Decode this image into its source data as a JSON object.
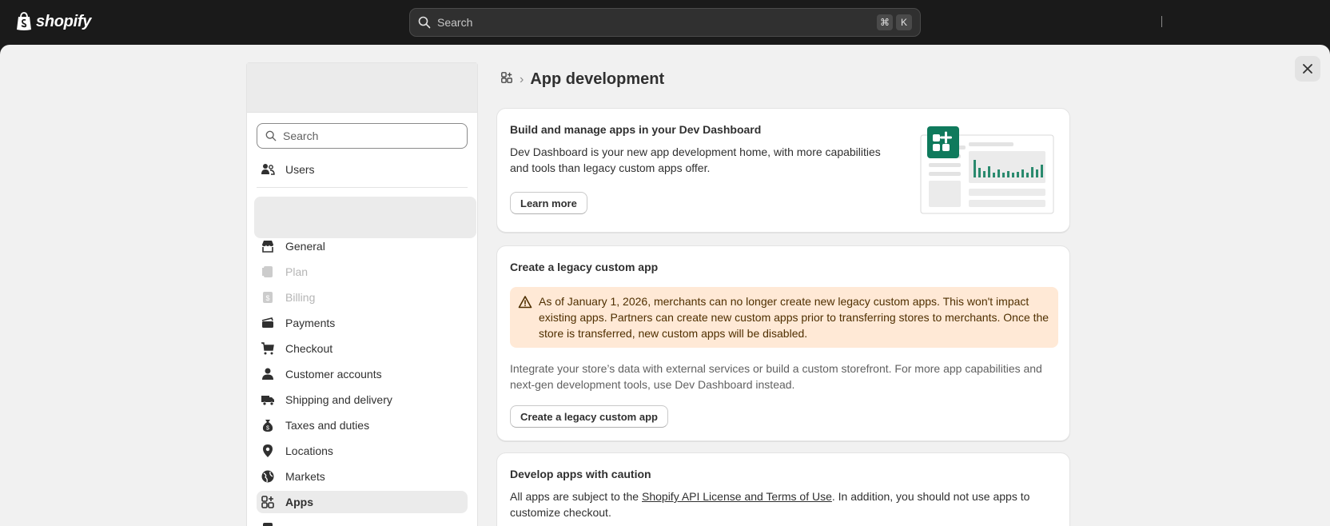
{
  "topbar": {
    "logo_text": "shopify",
    "search_placeholder": "Search",
    "shortcut_keys": [
      "⌘",
      "K"
    ]
  },
  "sidebar": {
    "search_placeholder": "Search",
    "users_label": "Users",
    "items": [
      {
        "label": "General",
        "icon": "store-icon",
        "disabled": false,
        "active": false
      },
      {
        "label": "Plan",
        "icon": "plan-icon",
        "disabled": true,
        "active": false
      },
      {
        "label": "Billing",
        "icon": "billing-icon",
        "disabled": true,
        "active": false
      },
      {
        "label": "Payments",
        "icon": "payments-icon",
        "disabled": false,
        "active": false
      },
      {
        "label": "Checkout",
        "icon": "cart-icon",
        "disabled": false,
        "active": false
      },
      {
        "label": "Customer accounts",
        "icon": "person-icon",
        "disabled": false,
        "active": false
      },
      {
        "label": "Shipping and delivery",
        "icon": "truck-icon",
        "disabled": false,
        "active": false
      },
      {
        "label": "Taxes and duties",
        "icon": "money-bag-icon",
        "disabled": false,
        "active": false
      },
      {
        "label": "Locations",
        "icon": "location-pin-icon",
        "disabled": false,
        "active": false
      },
      {
        "label": "Markets",
        "icon": "globe-icon",
        "disabled": false,
        "active": false
      },
      {
        "label": "Apps",
        "icon": "apps-icon",
        "disabled": false,
        "active": true
      }
    ]
  },
  "main": {
    "page_title": "App development",
    "dev_dashboard_card": {
      "title": "Build and manage apps in your Dev Dashboard",
      "body": "Dev Dashboard is your new app development home, with more capabilities and tools than legacy custom apps offer.",
      "button": "Learn more"
    },
    "legacy_card": {
      "title": "Create a legacy custom app",
      "banner": "As of January 1, 2026, merchants can no longer create new legacy custom apps. This won't impact existing apps. Partners can create new custom apps prior to transferring stores to merchants. Once the store is transferred, new custom apps will be disabled.",
      "body": "Integrate your store’s data with external services or build a custom storefront. For more app capabilities and next-gen development tools, use Dev Dashboard instead.",
      "button": "Create a legacy custom app"
    },
    "caution_card": {
      "title": "Develop apps with caution",
      "body_before": "All apps are subject to the ",
      "link": "Shopify API License and Terms of Use",
      "body_after": ". In addition, you should not use apps to customize checkout."
    }
  },
  "colors": {
    "topbar_bg": "#1a1a1a",
    "page_bg": "#f1f1f1",
    "banner_bg": "#ffe9d6",
    "illustration_green": "#0f7a5c"
  }
}
